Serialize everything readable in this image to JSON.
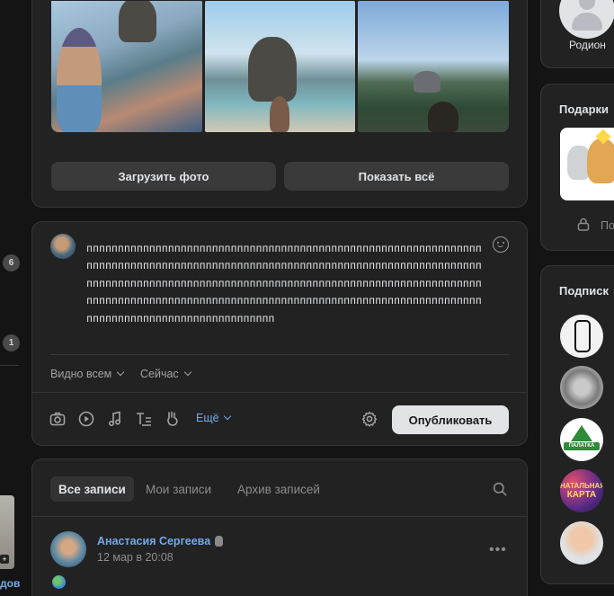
{
  "left_rail": {
    "badge_top": "6",
    "badge_bottom": "1",
    "cut_link": "дов"
  },
  "photos": {
    "upload_label": "Загрузить фото",
    "show_all_label": "Показать всё"
  },
  "composer": {
    "text": "пппппппппппппппппппппппппппппппппппппппппппппппппппппппппппппппппппппппппппппппппппппппппппппппппппппппппппппппппппппппппппппппппппппппппппппппппппппппппппппппппппппппппппппппппппппппппппппппппппппппппппппппппппппппппппппппппппппппппппппппппппппппппппппппппппппппппппппппппппппппппп",
    "visibility_label": "Видно всем",
    "time_label": "Сейчас",
    "more_label": "Ещё",
    "publish_label": "Опубликовать"
  },
  "feed": {
    "tabs": [
      "Все записи",
      "Мои записи",
      "Архив записей"
    ],
    "active_tab": "Все записи",
    "post": {
      "author": "Анастасия Сергеева",
      "date": "12 мар в 20:08"
    }
  },
  "sidebar": {
    "profile_name": "Родион",
    "gifts_title": "Подарки",
    "gifts_lock_text": "По",
    "subscriptions_title": "Подписк",
    "sub3_logo_text": "ПАЛАТКА",
    "sub4_logo_line1": "НАТАЛЬНАЯ",
    "sub4_logo_line2": "КАРТА"
  }
}
